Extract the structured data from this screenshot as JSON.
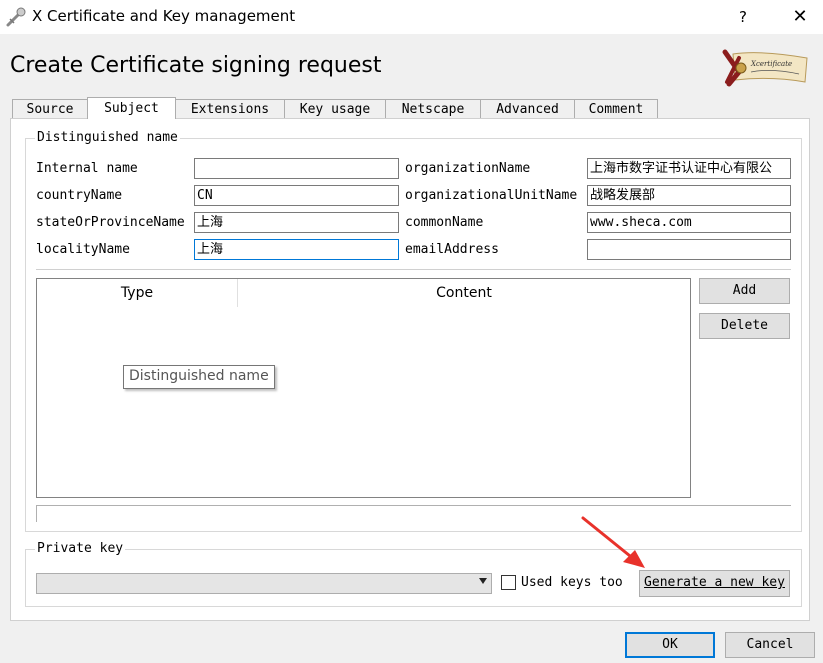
{
  "window": {
    "title": "X Certificate and Key management",
    "help_label": "?",
    "close_label": "✕"
  },
  "page": {
    "heading": "Create Certificate signing request",
    "logo_text": "Xcertificate"
  },
  "tabs": [
    {
      "label": "Source",
      "active": false
    },
    {
      "label": "Subject",
      "active": true
    },
    {
      "label": "Extensions",
      "active": false
    },
    {
      "label": "Key usage",
      "active": false
    },
    {
      "label": "Netscape",
      "active": false
    },
    {
      "label": "Advanced",
      "active": false
    },
    {
      "label": "Comment",
      "active": false
    }
  ],
  "distinguished_name": {
    "title": "Distinguished name",
    "fields": {
      "internal_name": {
        "label": "Internal name",
        "value": ""
      },
      "country_name": {
        "label": "countryName",
        "value": "CN"
      },
      "state_name": {
        "label": "stateOrProvinceName",
        "value": "上海"
      },
      "locality_name": {
        "label": "localityName",
        "value": "上海"
      },
      "organization_name": {
        "label": "organizationName",
        "value": "上海市数字证书认证中心有限公"
      },
      "organizational_unit_name": {
        "label": "organizationalUnitName",
        "value": "战略发展部"
      },
      "common_name": {
        "label": "commonName",
        "value": "www.sheca.com"
      },
      "email_address": {
        "label": "emailAddress",
        "value": ""
      }
    },
    "table": {
      "columns": [
        "Type",
        "Content"
      ],
      "rows": []
    },
    "add_label": "Add",
    "delete_label": "Delete",
    "tooltip": "Distinguished name"
  },
  "private_key": {
    "title": "Private key",
    "selected": "",
    "used_keys_label": "Used keys too",
    "used_keys_checked": false,
    "generate_label": "Generate a new key"
  },
  "footer": {
    "ok_label": "OK",
    "cancel_label": "Cancel"
  },
  "colors": {
    "focus": "#0078d7",
    "annotation_arrow": "#e8322b"
  }
}
